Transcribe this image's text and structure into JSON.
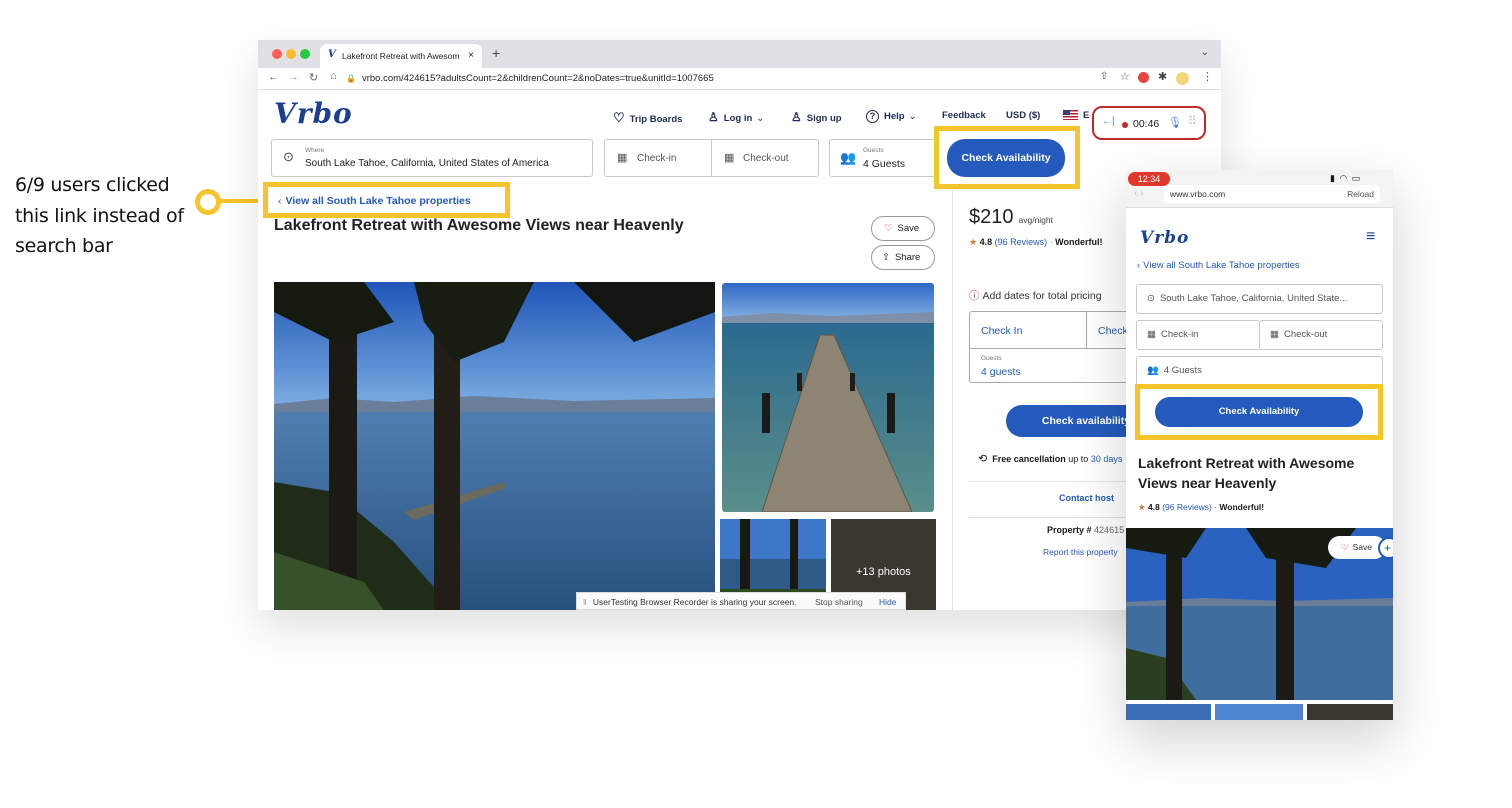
{
  "annotation": {
    "text": "6/9 users clicked this link instead of search bar"
  },
  "desktop": {
    "tab_title": "Lakefront Retreat with Awesom",
    "url": "vrbo.com/424615?adultsCount=2&childrenCount=2&noDates=true&unitId=1007665",
    "logo": "Vrbo",
    "nav": {
      "trip_boards": "Trip Boards",
      "log_in": "Log in",
      "sign_up": "Sign up",
      "help": "Help",
      "feedback": "Feedback",
      "currency": "USD ($)",
      "lang": "E"
    },
    "recorder": {
      "time": "00:46"
    },
    "search": {
      "where_label": "Where",
      "where_value": "South Lake Tahoe, California, United States of America",
      "checkin": "Check-in",
      "checkout": "Check-out",
      "guests_label": "Guests",
      "guests_value": "4 Guests",
      "button": "Check Availability"
    },
    "back_link": "View all South Lake Tahoe properties",
    "title": "Lakefront Retreat with Awesome Views near Heavenly",
    "save": "Save",
    "share": "Share",
    "photos_more": "+13 photos",
    "sharing_bar": {
      "text": "UserTesting Browser Recorder is sharing your screen.",
      "stop": "Stop sharing",
      "hide": "Hide"
    },
    "booking": {
      "price": "$210",
      "price_unit": "avg/night",
      "rating": "4.8",
      "reviews": "(96 Reviews)",
      "rating_word": "Wonderful!",
      "notice": "Add dates for total pricing",
      "check_in": "Check In",
      "check_out": "Check",
      "guests_label": "Guests",
      "guests_value": "4 guests",
      "button": "Check availability",
      "free_cancel": "Free cancellation",
      "free_cancel_rest": "up to",
      "free_cancel_days": "30 days",
      "contact": "Contact host",
      "property_label": "Property #",
      "property_num": "424615",
      "report": "Report this property"
    }
  },
  "mobile": {
    "time": "12:34",
    "url": "www.vrbo.com",
    "reload": "Reload",
    "logo": "Vrbo",
    "back_link": "View all South Lake Tahoe properties",
    "where": "South Lake Tahoe, California, United State...",
    "checkin": "Check-in",
    "checkout": "Check-out",
    "guests": "4 Guests",
    "button": "Check Availability",
    "title": "Lakefront Retreat with Awesome Views near Heavenly",
    "rating": "4.8",
    "reviews": "(96 Reviews)",
    "rating_word": "Wonderful!",
    "save": "Save"
  },
  "colors": {
    "highlight": "#f7c42b",
    "brand_blue": "#245abc",
    "logo_navy": "#1d3f8f",
    "recorder_red": "#c0282c"
  }
}
